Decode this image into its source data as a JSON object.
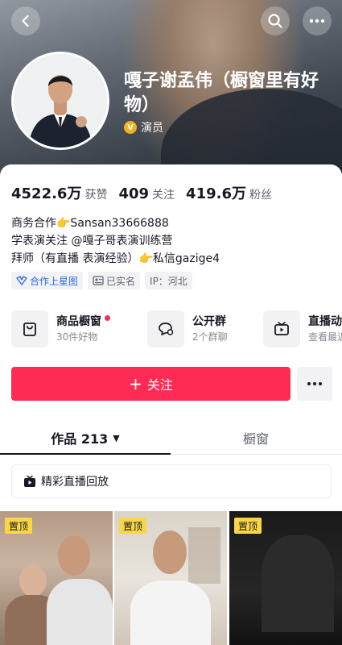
{
  "header": {
    "name": "嘎子谢孟伟（橱窗里有好物）",
    "role_badge": "V",
    "role": "演员"
  },
  "stats": [
    {
      "value": "4522.6万",
      "label": "获赞"
    },
    {
      "value": "409",
      "label": "关注"
    },
    {
      "value": "419.6万",
      "label": "粉丝"
    }
  ],
  "bio": {
    "line1": "商务合作👉Sansan33666888",
    "line2": "学表演关注 @嘎子哥表演训练营",
    "line3": "拜师（有直播 表演经验）👉私信gazige4"
  },
  "tags": {
    "star_map": "合作上星图",
    "verified": "已实名",
    "ip": "IP：河北"
  },
  "shortcuts": [
    {
      "title": "商品橱窗",
      "sub": "30件好物"
    },
    {
      "title": "公开群",
      "sub": "2个群聊"
    },
    {
      "title": "直播动态",
      "sub": "查看最近"
    }
  ],
  "actions": {
    "follow_plus": "+",
    "follow": "关注"
  },
  "tabs": {
    "works": "作品 213",
    "caret": "▼",
    "showcase": "橱窗"
  },
  "replay": {
    "label": "精彩直播回放"
  },
  "grid": {
    "pin_label": "置顶"
  },
  "colors": {
    "accent": "#fe2c55",
    "pin": "#f9d648",
    "link_blue": "#2b6de3",
    "badge_gold": "#f2b01e"
  }
}
